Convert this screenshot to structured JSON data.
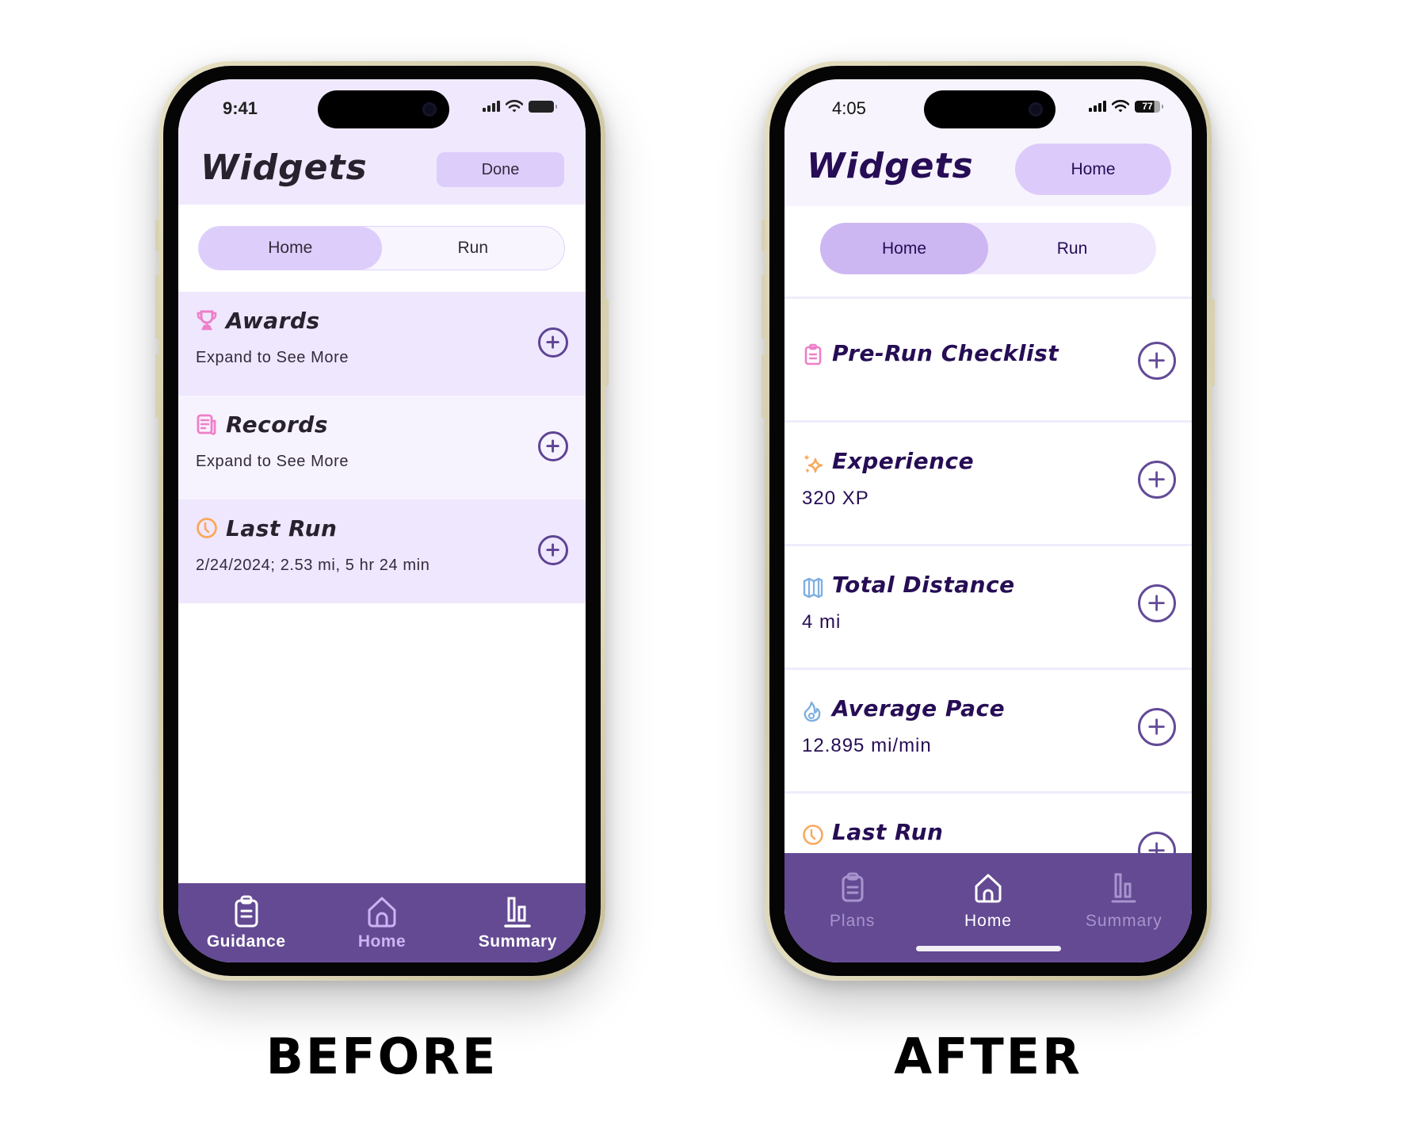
{
  "before": {
    "caption": "BEFORE",
    "status": {
      "time": "9:41",
      "battery": ""
    },
    "header": {
      "title": "Widgets",
      "action_label": "Done"
    },
    "segmented": [
      {
        "label": "Home",
        "active": true
      },
      {
        "label": "Run",
        "active": false
      }
    ],
    "widgets": [
      {
        "icon": "trophy-icon",
        "icon_color": "#ee7fc8",
        "title": "Awards",
        "subtitle": "Expand to See More"
      },
      {
        "icon": "records-icon",
        "icon_color": "#ee7fc8",
        "title": "Records",
        "subtitle": "Expand to See More"
      },
      {
        "icon": "clock-icon",
        "icon_color": "#f8a95c",
        "title": "Last Run",
        "subtitle": "2/24/2024; 2.53 mi, 5 hr 24 min"
      }
    ],
    "tabbar": [
      {
        "icon": "clipboard-icon",
        "label": "Guidance",
        "active": false
      },
      {
        "icon": "home-icon",
        "label": "Home",
        "active": true
      },
      {
        "icon": "bar-chart-icon",
        "label": "Summary",
        "active": false
      }
    ]
  },
  "after": {
    "caption": "AFTER",
    "status": {
      "time": "4:05",
      "battery": "77"
    },
    "header": {
      "title": "Widgets",
      "action_label": "Home"
    },
    "segmented": [
      {
        "label": "Home",
        "active": true
      },
      {
        "label": "Run",
        "active": false
      }
    ],
    "widgets": [
      {
        "icon": "clipboard-icon",
        "icon_color": "#ee7fc8",
        "title": "Pre-Run Checklist",
        "subtitle": ""
      },
      {
        "icon": "sparkles-icon",
        "icon_color": "#f8a95c",
        "title": "Experience",
        "subtitle": "320 XP"
      },
      {
        "icon": "map-icon",
        "icon_color": "#7fb0e0",
        "title": "Total Distance",
        "subtitle": "4 mi"
      },
      {
        "icon": "flame-icon",
        "icon_color": "#7fb0e0",
        "title": "Average Pace",
        "subtitle": "12.895 mi/min"
      },
      {
        "icon": "clock-icon",
        "icon_color": "#f8a95c",
        "title": "Last Run",
        "subtitle": ""
      }
    ],
    "tabbar": [
      {
        "icon": "clipboard-icon",
        "label": "Plans",
        "active": false
      },
      {
        "icon": "home-icon",
        "label": "Home",
        "active": true
      },
      {
        "icon": "bar-chart-icon",
        "label": "Summary",
        "active": false
      }
    ]
  },
  "colors": {
    "tabbar_bg": "#634a93",
    "accent_purple": "#5e4394",
    "title_dark_before": "#28222f",
    "title_dark_after": "#260d55",
    "chip_lavender": "#ddcdfb"
  }
}
